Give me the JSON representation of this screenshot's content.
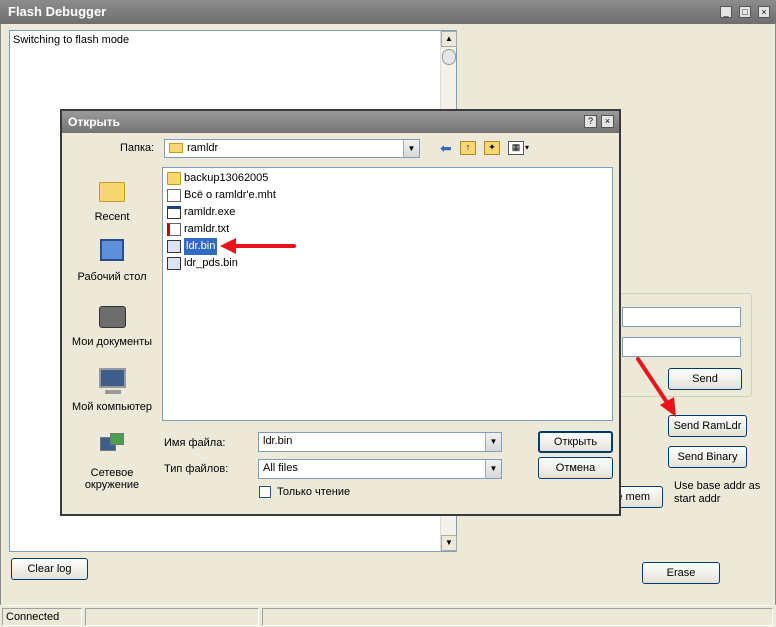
{
  "window": {
    "title": "Flash Debugger",
    "log_text": "Switching to flash mode",
    "buttons": {
      "clear_log": "Clear log",
      "send": "Send",
      "send_ramldr": "Send RamLdr",
      "send_binary": "Send Binary",
      "mem_partial": "e mem",
      "erase": "Erase"
    },
    "base_addr_note": "Use base addr as start addr",
    "status": {
      "connection": "Connected"
    }
  },
  "dialog": {
    "title": "Открыть",
    "folder_label": "Папка:",
    "folder_value": "ramldr",
    "places": [
      {
        "label": "Recent",
        "icon": "recent-folder-icon"
      },
      {
        "label": "Рабочий стол",
        "icon": "desktop-icon"
      },
      {
        "label": "Мои документы",
        "icon": "my-documents-icon"
      },
      {
        "label": "Мой компьютер",
        "icon": "my-computer-icon"
      },
      {
        "label": "Сетевое окружение",
        "icon": "network-icon"
      }
    ],
    "files": [
      {
        "name": "backup13062005",
        "icon": "folder-icon",
        "selected": false
      },
      {
        "name": "Всё о ramldr'e.mht",
        "icon": "mht-file-icon",
        "selected": false
      },
      {
        "name": "ramldr.exe",
        "icon": "exe-file-icon",
        "selected": false
      },
      {
        "name": "ramldr.txt",
        "icon": "txt-file-icon",
        "selected": false
      },
      {
        "name": "ldr.bin",
        "icon": "bin-file-icon",
        "selected": true
      },
      {
        "name": "ldr_pds.bin",
        "icon": "bin-file-icon",
        "selected": false
      }
    ],
    "filename_label": "Имя файла:",
    "filename_value": "ldr.bin",
    "filetype_label": "Тип файлов:",
    "filetype_value": "All files",
    "readonly_label": "Только чтение",
    "readonly_checked": false,
    "open_button": "Открыть",
    "cancel_button": "Отмена"
  },
  "colors": {
    "selection": "#316ac5",
    "annotation_arrow": "#e8141a"
  }
}
